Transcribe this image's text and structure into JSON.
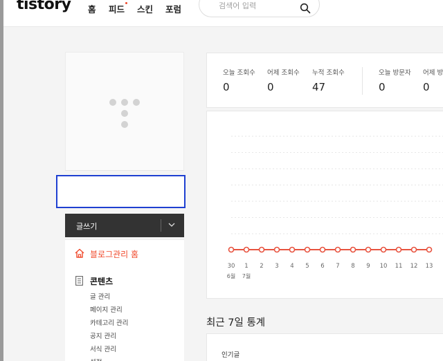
{
  "header": {
    "logo": "tistory",
    "nav": [
      "홈",
      "피드",
      "스킨",
      "포럼"
    ],
    "search_placeholder": "검색어 입력"
  },
  "sidebar": {
    "write_label": "글쓰기",
    "home_label": "블로그관리 홈",
    "section_label": "콘텐츠",
    "sub_items": [
      "글 관리",
      "페이지 관리",
      "카테고리 관리",
      "공지 관리",
      "서식 관리",
      "설정"
    ]
  },
  "stats": [
    {
      "label": "오늘 조회수",
      "value": "0"
    },
    {
      "label": "어제 조회수",
      "value": "0"
    },
    {
      "label": "누적 조회수",
      "value": "47"
    },
    {
      "label": "오늘 방문자",
      "value": "0"
    },
    {
      "label": "어제 방문자",
      "value": "0"
    }
  ],
  "chart_data": {
    "type": "line",
    "x": [
      "30",
      "1",
      "2",
      "3",
      "4",
      "5",
      "6",
      "7",
      "8",
      "9",
      "10",
      "11",
      "12",
      "13"
    ],
    "month_labels": [
      "6월",
      "7월"
    ],
    "series": [
      {
        "values": [
          0,
          0,
          0,
          0,
          0,
          0,
          0,
          0,
          0,
          0,
          0,
          0,
          0,
          0
        ]
      }
    ],
    "color": "#e8533f",
    "grid": true
  },
  "recent": {
    "title": "최근 7일 통계",
    "popular_label": "인기글"
  }
}
